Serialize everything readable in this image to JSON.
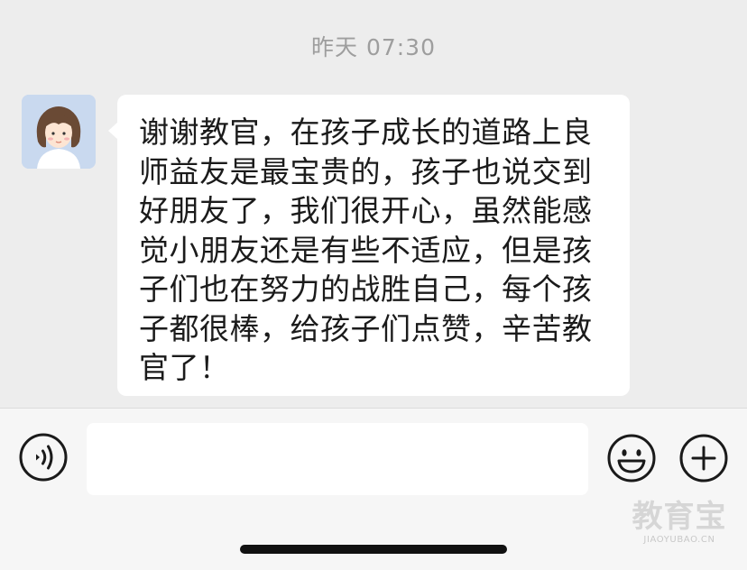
{
  "chat": {
    "timestamp": "昨天 07:30",
    "messages": [
      {
        "sender": "other",
        "avatar_icon": "girl-avatar-icon",
        "text": "谢谢教官，在孩子成长的道路上良师益友是最宝贵的，孩子也说交到好朋友了，我们很开心，虽然能感觉小朋友还是有些不适应，但是孩子们也在努力的战胜自己，每个孩子都很棒，给孩子们点赞，辛苦教官了！"
      }
    ]
  },
  "input_bar": {
    "voice_icon": "voice-icon",
    "input_value": "",
    "emoji_icon": "emoji-icon",
    "more_icon": "plus-icon"
  },
  "watermark": {
    "main": "教育宝",
    "sub": "JIAOYUBAO.CN"
  },
  "colors": {
    "background": "#ededed",
    "bubble": "#ffffff",
    "timestamp_text": "#9e9e9e",
    "message_text": "#1b1b1b",
    "input_bar": "#f6f6f6"
  }
}
